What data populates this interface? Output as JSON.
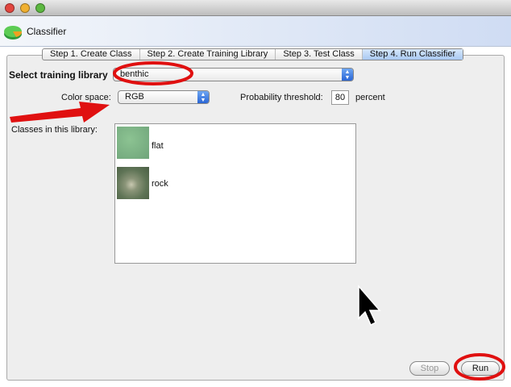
{
  "window": {
    "app_title": "Classifier"
  },
  "tabs": [
    {
      "label": "Step 1. Create Class"
    },
    {
      "label": "Step 2. Create Training Library"
    },
    {
      "label": "Step 3. Test Class"
    },
    {
      "label": "Step 4. Run Classifier",
      "active": true
    }
  ],
  "form": {
    "training_library_label": "Select training library",
    "training_library_value": "benthic",
    "color_space_label": "Color space:",
    "color_space_value": "RGB",
    "threshold_label": "Probability threshold:",
    "threshold_value": "80",
    "threshold_unit": "percent",
    "classes_label": "Classes in this library:"
  },
  "classes": [
    {
      "name": "flat",
      "thumb_color": "#6fa47a"
    },
    {
      "name": "rock",
      "thumb_color": "#5f7456"
    }
  ],
  "buttons": {
    "stop": "Stop",
    "run": "Run"
  },
  "annotation_color": "#e01010"
}
